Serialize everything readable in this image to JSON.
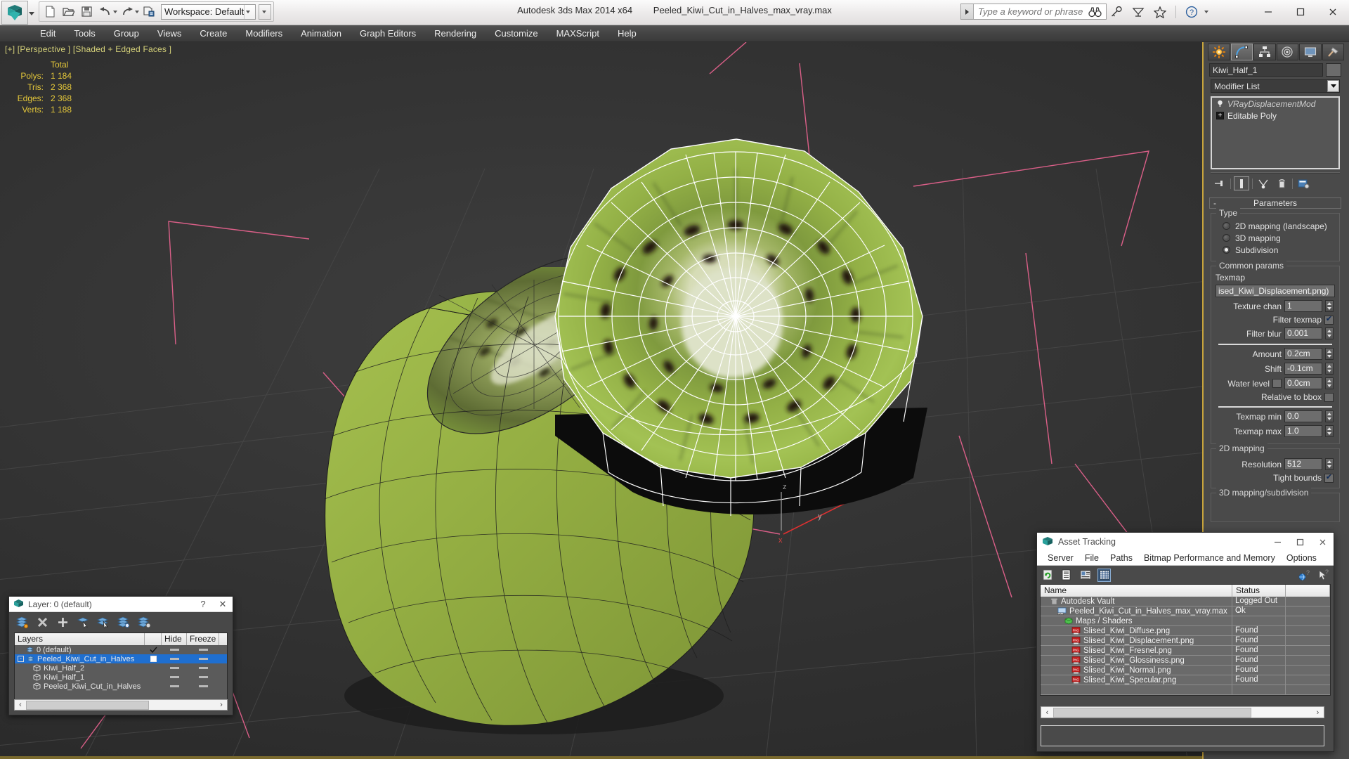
{
  "app": {
    "title": "Autodesk 3ds Max  2014 x64",
    "filename": "Peeled_Kiwi_Cut_in_Halves_max_vray.max",
    "logo_icon": "3dsmax-logo-icon"
  },
  "quick_access": {
    "workspace_label": "Workspace: Default",
    "buttons": [
      {
        "name": "new-file-button",
        "icon": "new-file-icon"
      },
      {
        "name": "open-file-button",
        "icon": "open-folder-icon"
      },
      {
        "name": "save-file-button",
        "icon": "save-disk-icon"
      },
      {
        "name": "undo-button",
        "icon": "undo-arrow-icon"
      },
      {
        "name": "redo-button",
        "icon": "redo-arrow-icon"
      },
      {
        "name": "project-folder-button",
        "icon": "project-folder-icon"
      }
    ]
  },
  "search": {
    "placeholder": "Type a keyword or phrase",
    "value": ""
  },
  "info_icons": [
    {
      "name": "binoculars-icon",
      "label": "binoculars"
    },
    {
      "name": "key-icon",
      "label": "key"
    },
    {
      "name": "satellite-dish-icon",
      "label": "satellite"
    },
    {
      "name": "star-icon",
      "label": "favorites"
    },
    {
      "name": "help-icon",
      "label": "?"
    }
  ],
  "window_controls": {
    "minimize": "—",
    "maximize": "☐",
    "close": "✕"
  },
  "menubar": {
    "items": [
      "Edit",
      "Tools",
      "Group",
      "Views",
      "Create",
      "Modifiers",
      "Animation",
      "Graph Editors",
      "Rendering",
      "Customize",
      "MAXScript",
      "Help"
    ]
  },
  "viewport": {
    "label": "[+] [Perspective ] [Shaded + Edged Faces ]",
    "stats": {
      "header": "Total",
      "rows": [
        {
          "key": "Polys:",
          "value": "1 184"
        },
        {
          "key": "Tris:",
          "value": "2 368"
        },
        {
          "key": "Edges:",
          "value": "2 368"
        },
        {
          "key": "Verts:",
          "value": "1 188"
        }
      ]
    },
    "colors": {
      "background": "#333333",
      "kiwi_skin": "#8fae3f",
      "kiwi_flesh": "#9cbc4b",
      "kiwi_core": "#d8ddc0",
      "wire_white": "#ffffff",
      "wire_black": "#111111",
      "gizmo_pink": "#ff6fa0",
      "gizmo_red": "#e03030"
    }
  },
  "command_panel": {
    "tabs": [
      {
        "name": "create-tab",
        "icon": "star-burst-icon",
        "active": false
      },
      {
        "name": "modify-tab",
        "icon": "curve-icon",
        "active": true
      },
      {
        "name": "hierarchy-tab",
        "icon": "hierarchy-icon",
        "active": false
      },
      {
        "name": "motion-tab",
        "icon": "wheel-icon",
        "active": false
      },
      {
        "name": "display-tab",
        "icon": "monitor-icon",
        "active": false
      },
      {
        "name": "utilities-tab",
        "icon": "hammer-icon",
        "active": false
      }
    ],
    "object_name": "Kiwi_Half_1",
    "modifier_list_label": "Modifier List",
    "modifier_stack": [
      {
        "label": "VRayDisplacementMod",
        "italic": true,
        "icon": "lightbulb-icon"
      },
      {
        "label": "Editable Poly",
        "italic": false,
        "icon": "plus-box-icon"
      }
    ],
    "stack_tools": [
      {
        "name": "pin-stack-button",
        "icon": "pin-icon"
      },
      {
        "name": "show-end-result-button",
        "icon": "show-result-icon"
      },
      {
        "name": "make-unique-button",
        "icon": "make-unique-icon"
      },
      {
        "name": "remove-modifier-button",
        "icon": "trash-icon"
      },
      {
        "name": "configure-sets-button",
        "icon": "configure-icon"
      }
    ],
    "rollout": {
      "title": "Parameters",
      "collapse_glyph": "-",
      "type_group": {
        "label": "Type",
        "options": [
          {
            "label": "2D mapping (landscape)",
            "selected": false
          },
          {
            "label": "3D mapping",
            "selected": false
          },
          {
            "label": "Subdivision",
            "selected": true
          }
        ]
      },
      "common_params": {
        "label": "Common params",
        "texmap_label": "Texmap",
        "texmap_value": "ised_Kiwi_Displacement.png)",
        "fields": [
          {
            "label": "Texture chan",
            "value": "1",
            "spinner": true
          },
          {
            "label": "Filter texmap",
            "checkbox": true,
            "checked": true
          },
          {
            "label": "Filter blur",
            "value": "0.001",
            "spinner": true
          },
          {
            "label": "Amount",
            "value": "0.2cm",
            "spinner": true
          },
          {
            "label": "Shift",
            "value": "-0.1cm",
            "spinner": true
          },
          {
            "label": "Water level",
            "value": "0.0cm",
            "spinner": true,
            "checkbox": true,
            "checked": false
          },
          {
            "label": "Relative to bbox",
            "checkbox": true,
            "checked": false
          },
          {
            "label": "Texmap min",
            "value": "0.0",
            "spinner": true
          },
          {
            "label": "Texmap max",
            "value": "1.0",
            "spinner": true
          }
        ]
      },
      "mapping_2d": {
        "label": "2D mapping",
        "resolution_label": "Resolution",
        "resolution_value": "512",
        "tight_bounds_label": "Tight bounds",
        "tight_bounds_checked": true
      },
      "mapping_3d_label": "3D mapping/subdivision"
    }
  },
  "layer_dialog": {
    "title": "Layer: 0 (default)",
    "help_glyph": "?",
    "close_glyph": "✕",
    "toolbar": [
      {
        "name": "create-new-layer-button",
        "icon": "new-layer-icon"
      },
      {
        "name": "delete-layer-button",
        "icon": "delete-x-icon"
      },
      {
        "name": "add-selection-button",
        "icon": "plus-icon"
      },
      {
        "name": "select-objects-in-layer-button",
        "icon": "select-layer-icon"
      },
      {
        "name": "select-highlighted-button",
        "icon": "select-highlighted-icon"
      },
      {
        "name": "highlight-selected-button",
        "icon": "highlight-selected-icon"
      },
      {
        "name": "layer-properties-button",
        "icon": "layer-properties-icon"
      }
    ],
    "columns": [
      "Layers",
      "",
      "Hide",
      "Freeze"
    ],
    "rows": [
      {
        "label": "0 (default)",
        "indent": 1,
        "icon": "layer-icon",
        "selected": false,
        "current": "check",
        "hide": "dash",
        "freeze": "dash"
      },
      {
        "label": "Peeled_Kiwi_Cut_in_Halves",
        "indent": 0,
        "icon": "layer-icon",
        "selected": true,
        "current": "box",
        "hide": "dash",
        "freeze": "dash",
        "expander": "-"
      },
      {
        "label": "Kiwi_Half_2",
        "indent": 2,
        "icon": "object-icon",
        "selected": false,
        "current": "",
        "hide": "dash",
        "freeze": "dash"
      },
      {
        "label": "Kiwi_Half_1",
        "indent": 2,
        "icon": "object-icon",
        "selected": false,
        "current": "",
        "hide": "dash",
        "freeze": "dash"
      },
      {
        "label": "Peeled_Kiwi_Cut_in_Halves",
        "indent": 2,
        "icon": "object-icon",
        "selected": false,
        "current": "",
        "hide": "dash",
        "freeze": "dash"
      }
    ],
    "scroll": {
      "left_glyph": "‹",
      "right_glyph": "›"
    }
  },
  "asset_tracking": {
    "title": "Asset Tracking",
    "window_controls": {
      "minimize": "—",
      "maximize": "☐",
      "close": "✕"
    },
    "menu": [
      "Server",
      "File",
      "Paths",
      "Bitmap Performance and Memory",
      "Options"
    ],
    "toolbar": [
      {
        "name": "refresh-button",
        "icon": "refresh-icon",
        "selected": false
      },
      {
        "name": "list-view-button",
        "icon": "list-icon",
        "selected": false
      },
      {
        "name": "detail-view-button",
        "icon": "detail-icon",
        "selected": false
      },
      {
        "name": "grid-view-button",
        "icon": "grid-icon",
        "selected": true
      }
    ],
    "toolbar_right": [
      {
        "name": "help-globe-icon",
        "icon": "help-globe-icon"
      },
      {
        "name": "help-cursor-icon",
        "icon": "help-cursor-icon"
      }
    ],
    "columns": [
      "Name",
      "Status",
      ""
    ],
    "rows": [
      {
        "name": "Autodesk Vault",
        "status": "Logged Out ...",
        "indent": 0,
        "icon": "vault-icon"
      },
      {
        "name": "Peeled_Kiwi_Cut_in_Halves_max_vray.max",
        "status": "Ok",
        "indent": 1,
        "icon": "max-file-icon"
      },
      {
        "name": "Maps / Shaders",
        "status": "",
        "indent": 2,
        "icon": "maps-icon"
      },
      {
        "name": "Slised_Kiwi_Diffuse.png",
        "status": "Found",
        "indent": 3,
        "icon": "png-icon"
      },
      {
        "name": "Slised_Kiwi_Displacement.png",
        "status": "Found",
        "indent": 3,
        "icon": "png-icon"
      },
      {
        "name": "Slised_Kiwi_Fresnel.png",
        "status": "Found",
        "indent": 3,
        "icon": "png-icon"
      },
      {
        "name": "Slised_Kiwi_Glossiness.png",
        "status": "Found",
        "indent": 3,
        "icon": "png-icon"
      },
      {
        "name": "Slised_Kiwi_Normal.png",
        "status": "Found",
        "indent": 3,
        "icon": "png-icon"
      },
      {
        "name": "Slised_Kiwi_Specular.png",
        "status": "Found",
        "indent": 3,
        "icon": "png-icon"
      },
      {
        "name": "",
        "status": "",
        "indent": 0,
        "icon": ""
      }
    ],
    "scroll": {
      "left_glyph": "‹",
      "right_glyph": "›"
    },
    "status_text": ""
  }
}
